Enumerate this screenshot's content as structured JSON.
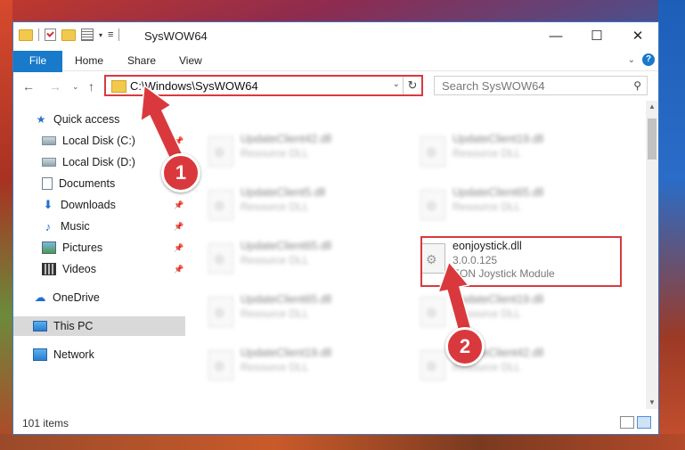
{
  "window": {
    "title": "SysWOW64",
    "controls": {
      "minimize": "—",
      "maximize": "☐",
      "close": "✕"
    }
  },
  "ribbon": {
    "tabs": [
      "File",
      "Home",
      "Share",
      "View"
    ]
  },
  "navbar": {
    "path": "C:\\Windows\\SysWOW64",
    "search_placeholder": "Search SysWOW64"
  },
  "sidebar": {
    "items": [
      {
        "label": "Quick access",
        "icon": "star-icon",
        "pinned": false
      },
      {
        "label": "Local Disk (C:)",
        "icon": "drive-icon",
        "pinned": true
      },
      {
        "label": "Local Disk (D:)",
        "icon": "drive-icon",
        "pinned": false
      },
      {
        "label": "Documents",
        "icon": "documents-icon",
        "pinned": true
      },
      {
        "label": "Downloads",
        "icon": "downloads-icon",
        "pinned": true
      },
      {
        "label": "Music",
        "icon": "music-icon",
        "pinned": true
      },
      {
        "label": "Pictures",
        "icon": "pictures-icon",
        "pinned": true
      },
      {
        "label": "Videos",
        "icon": "videos-icon",
        "pinned": true
      },
      {
        "label": "OneDrive",
        "icon": "onedrive-icon",
        "pinned": false
      },
      {
        "label": "This PC",
        "icon": "this-pc-icon",
        "pinned": false,
        "selected": true
      },
      {
        "label": "Network",
        "icon": "network-icon",
        "pinned": false
      }
    ]
  },
  "files": [
    {
      "name": "UpdateClient42.dll",
      "desc": "Resource DLL"
    },
    {
      "name": "UpdateClient19.dll",
      "desc": "Resource DLL"
    },
    {
      "name": "UpdateClient5.dll",
      "desc": "Resource DLL"
    },
    {
      "name": "UpdateClient65.dll",
      "desc": "Resource DLL"
    },
    {
      "name": "UpdateClient65.dll",
      "desc": "Resource DLL"
    },
    {
      "name": "eonjoystick.dll",
      "version": "3.0.0.125",
      "desc": "EON Joystick Module"
    },
    {
      "name": "UpdateClient65.dll",
      "desc": "Resource DLL"
    },
    {
      "name": "UpdateClient19.dll",
      "desc": "Resource DLL"
    },
    {
      "name": "UpdateClient19.dll",
      "desc": "Resource DLL"
    },
    {
      "name": "UpdateClient42.dll",
      "desc": "Resource DLL"
    }
  ],
  "status": {
    "item_count": "101 items"
  },
  "annotations": {
    "step1": "1",
    "step2": "2",
    "color": "#d9393d"
  }
}
